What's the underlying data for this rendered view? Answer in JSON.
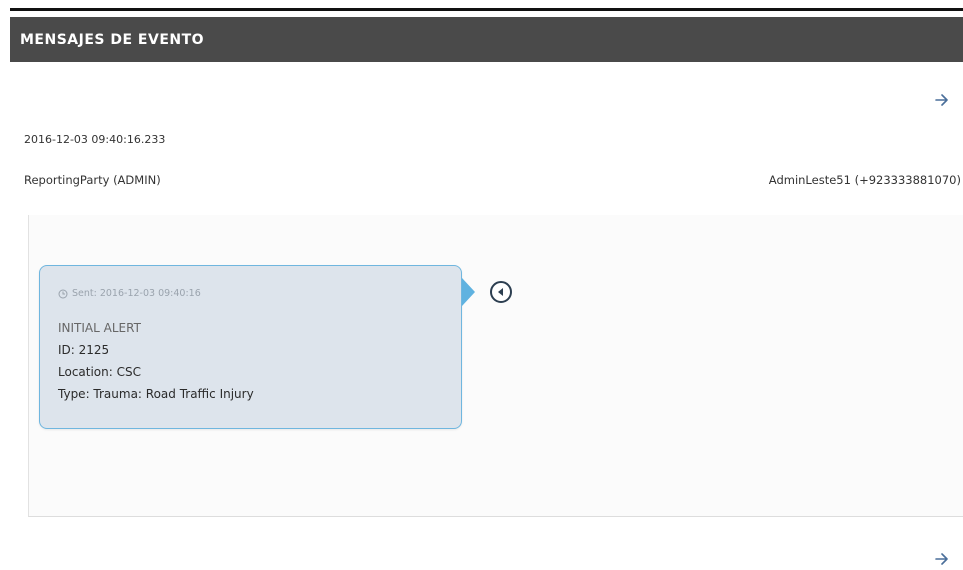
{
  "header": {
    "title": "MENSAJES DE EVENTO"
  },
  "message": {
    "timestamp": "2016-12-03 09:40:16.233",
    "reporting_party": "ReportingParty (ADMIN)",
    "admin_contact": "AdminLeste51 (+923333881070)",
    "card": {
      "header_text": "Sent: 2016-12-03 09:40:16",
      "lines": [
        "INITIAL ALERT",
        "ID: 2125",
        "Location: CSC",
        "Type: Trauma: Road Traffic Injury"
      ]
    }
  },
  "icons": {
    "arrow_top": "arrow-right-icon",
    "arrow_bottom": "arrow-right-icon",
    "clock": "clock-icon",
    "status": "radio-status-icon"
  },
  "colors": {
    "header_bg": "#4a4a4a",
    "accent": "#5fb2e0",
    "card_bg": "#dde4ec"
  }
}
